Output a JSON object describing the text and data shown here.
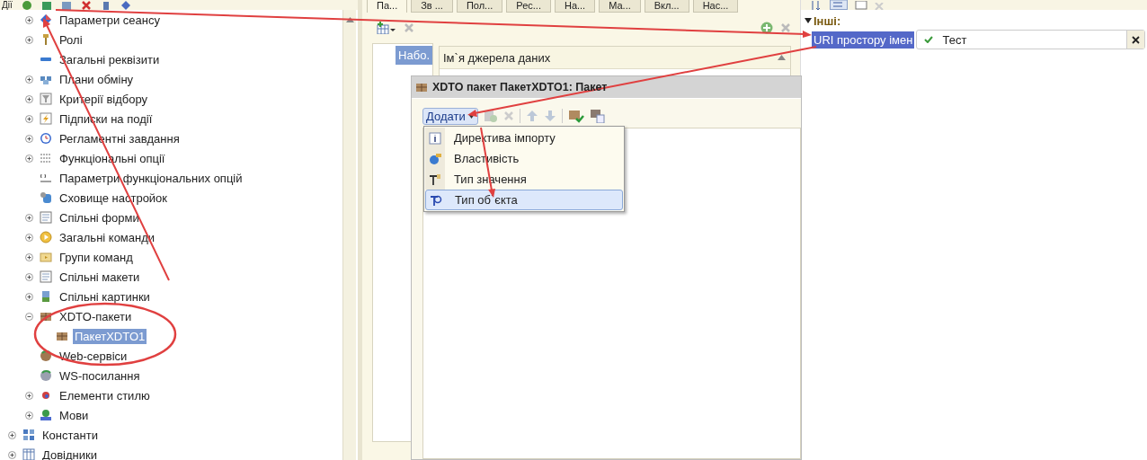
{
  "toolbar": {
    "label": "Дії"
  },
  "tree": {
    "items": [
      {
        "label": "Параметри сеансу",
        "expanded": false,
        "selected": false
      },
      {
        "label": "Ролі",
        "expanded": false,
        "selected": false
      },
      {
        "label": "Загальні реквізити",
        "selected": false
      },
      {
        "label": "Плани обміну",
        "expanded": false,
        "selected": false
      },
      {
        "label": "Критерії відбору",
        "expanded": false,
        "selected": false
      },
      {
        "label": "Підписки на події",
        "expanded": false,
        "selected": false
      },
      {
        "label": "Регламентні завдання",
        "expanded": false,
        "selected": false
      },
      {
        "label": "Функціональні опції",
        "expanded": false,
        "selected": false
      },
      {
        "label": "Параметри функціональних опцій",
        "selected": false
      },
      {
        "label": "Сховище настройок",
        "selected": false
      },
      {
        "label": "Спільні форми",
        "expanded": false,
        "selected": false
      },
      {
        "label": "Загальні команди",
        "expanded": false,
        "selected": false
      },
      {
        "label": "Групи команд",
        "expanded": false,
        "selected": false
      },
      {
        "label": "Спільні макети",
        "expanded": false,
        "selected": false
      },
      {
        "label": "Спільні картинки",
        "expanded": false,
        "selected": false
      },
      {
        "label": "XDTO-пакети",
        "expanded": true,
        "selected": false,
        "children": [
          {
            "label": "ПакетXDTO1",
            "selected": true
          }
        ]
      },
      {
        "label": "Web-сервіси",
        "selected": false
      },
      {
        "label": "WS-посилання",
        "selected": false
      },
      {
        "label": "Елементи стилю",
        "expanded": false,
        "selected": false
      },
      {
        "label": "Мови",
        "expanded": false,
        "selected": false
      }
    ],
    "root_items": [
      {
        "label": "Константи",
        "expanded": false,
        "selected": false
      },
      {
        "label": "Довідники",
        "expanded": false,
        "selected": false
      }
    ]
  },
  "tabs": [
    {
      "label": "Па...",
      "selected": true
    },
    {
      "label": "Зв ...",
      "selected": false
    },
    {
      "label": "Пол...",
      "selected": false
    },
    {
      "label": "Рес...",
      "selected": false
    },
    {
      "label": "На...",
      "selected": false
    },
    {
      "label": "Ма...",
      "selected": false
    },
    {
      "label": "Вкл...",
      "selected": false
    },
    {
      "label": "Нас...",
      "selected": false
    }
  ],
  "sources_list": {
    "items": [
      {
        "label": "Набо.",
        "selected": true
      }
    ]
  },
  "sources_table": {
    "columns": [
      "Ім`я джерела даних"
    ]
  },
  "xdto_window": {
    "title": "XDTO пакет ПакетXDTO1: Пакет",
    "add_button": "Додати",
    "menu": [
      {
        "label": "Директива імпорту",
        "selected": false
      },
      {
        "label": "Властивість",
        "selected": false
      },
      {
        "label": "Тип значення",
        "selected": false
      },
      {
        "label": "Тип об`єкта",
        "selected": true
      }
    ]
  },
  "properties": {
    "group": {
      "label": "Інші:",
      "expanded": true
    },
    "rows": [
      {
        "label": "URI простору імен",
        "selected": true,
        "value": "Тест",
        "valid": true
      }
    ]
  }
}
